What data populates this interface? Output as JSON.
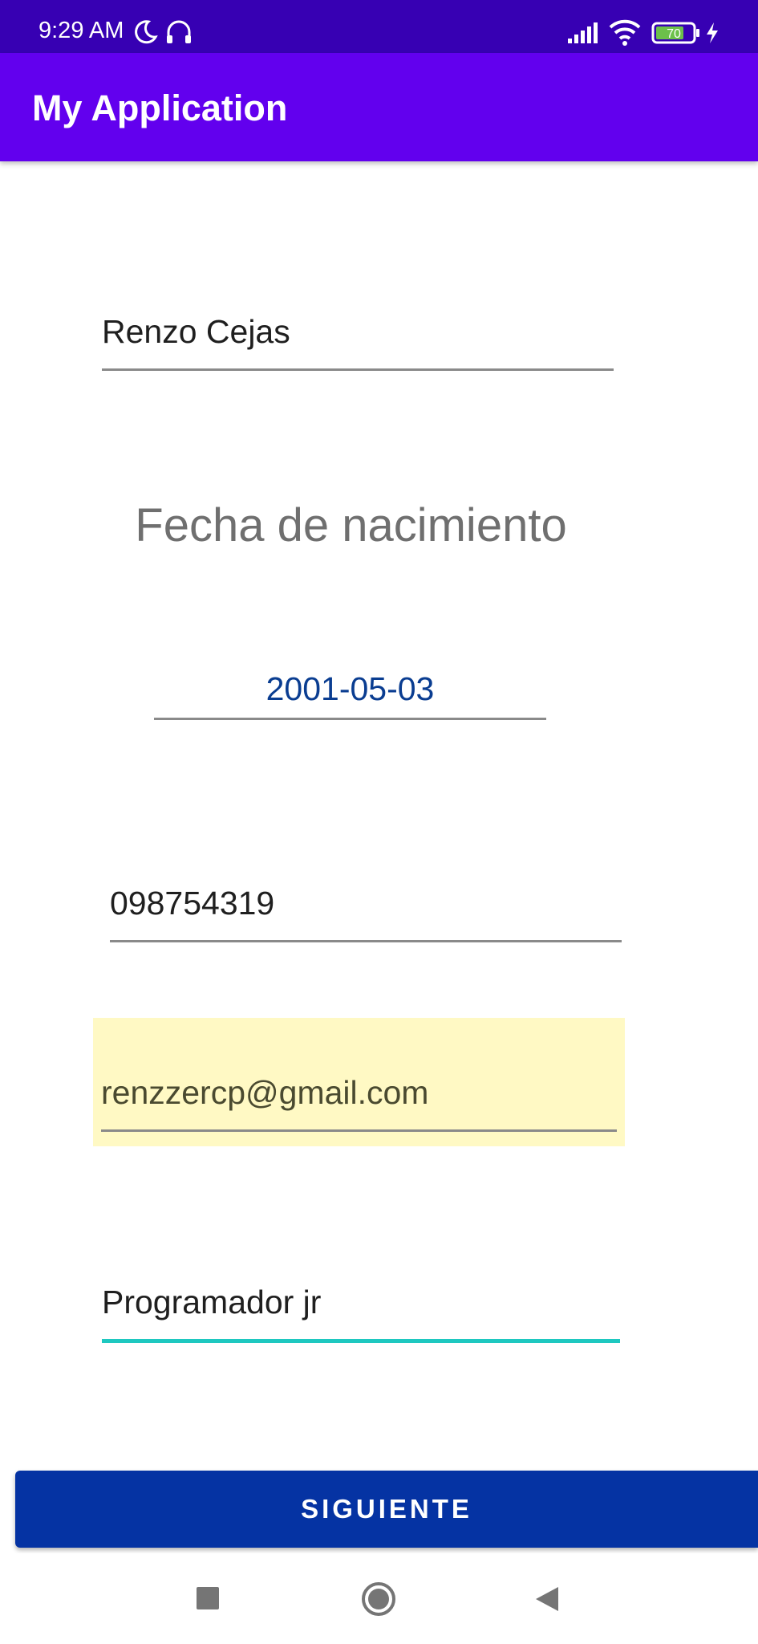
{
  "status_bar": {
    "time": "9:29 AM",
    "icons": [
      "moon-icon",
      "headphones-icon",
      "signal-icon",
      "wifi-icon",
      "battery-icon",
      "charging-icon"
    ],
    "battery_level": "70"
  },
  "app_bar": {
    "title": "My Application"
  },
  "form": {
    "name_value": "Renzo Cejas",
    "birth_label": "Fecha de nacimiento",
    "birth_value": "2001-05-03",
    "phone_value": "098754319",
    "email_value": "renzzercp@gmail.com",
    "job_value": "Programador jr"
  },
  "button": {
    "label": "SIGUIENTE"
  },
  "nav_bar": {
    "icons": [
      "recents-square-icon",
      "home-circle-icon",
      "back-triangle-icon"
    ]
  },
  "colors": {
    "status_bar": "#3700b3",
    "app_bar": "#6200ee",
    "button": "#0533a3",
    "date_text": "#0a3d91",
    "autofill_highlight": "#fff9c4",
    "focused_underline": "#1ec8c0"
  }
}
